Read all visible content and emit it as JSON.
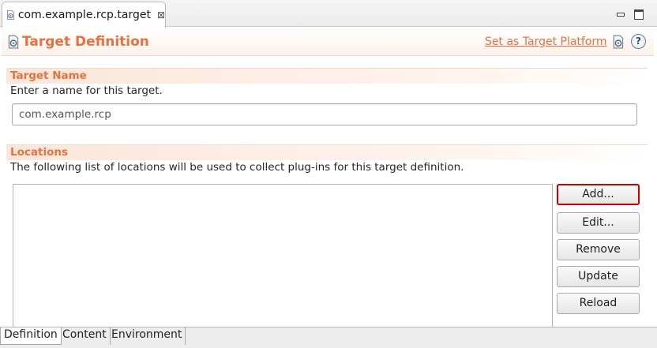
{
  "editor_tab": {
    "title": "com.example.rcp.target",
    "close_glyph": "⊠"
  },
  "header": {
    "title": "Target Definition",
    "link_label": "Set as Target Platform",
    "help_glyph": "?"
  },
  "target_name_section": {
    "title": "Target Name",
    "description": "Enter a name for this target.",
    "value": "com.example.rcp"
  },
  "locations_section": {
    "title": "Locations",
    "description": "The following list of locations will be used to collect plug-ins for this target definition.",
    "items": [],
    "buttons": {
      "add": "Add...",
      "edit": "Edit...",
      "remove": "Remove",
      "update": "Update",
      "reload": "Reload"
    }
  },
  "page_tabs": [
    "Definition",
    "Content",
    "Environment"
  ],
  "colors": {
    "accent": "#e4733f",
    "focus_outline": "#cc0000"
  },
  "icons": [
    "target-file-icon",
    "close-icon",
    "minimize-icon",
    "maximize-icon",
    "target-definition-icon",
    "set-target-icon",
    "help-icon"
  ]
}
